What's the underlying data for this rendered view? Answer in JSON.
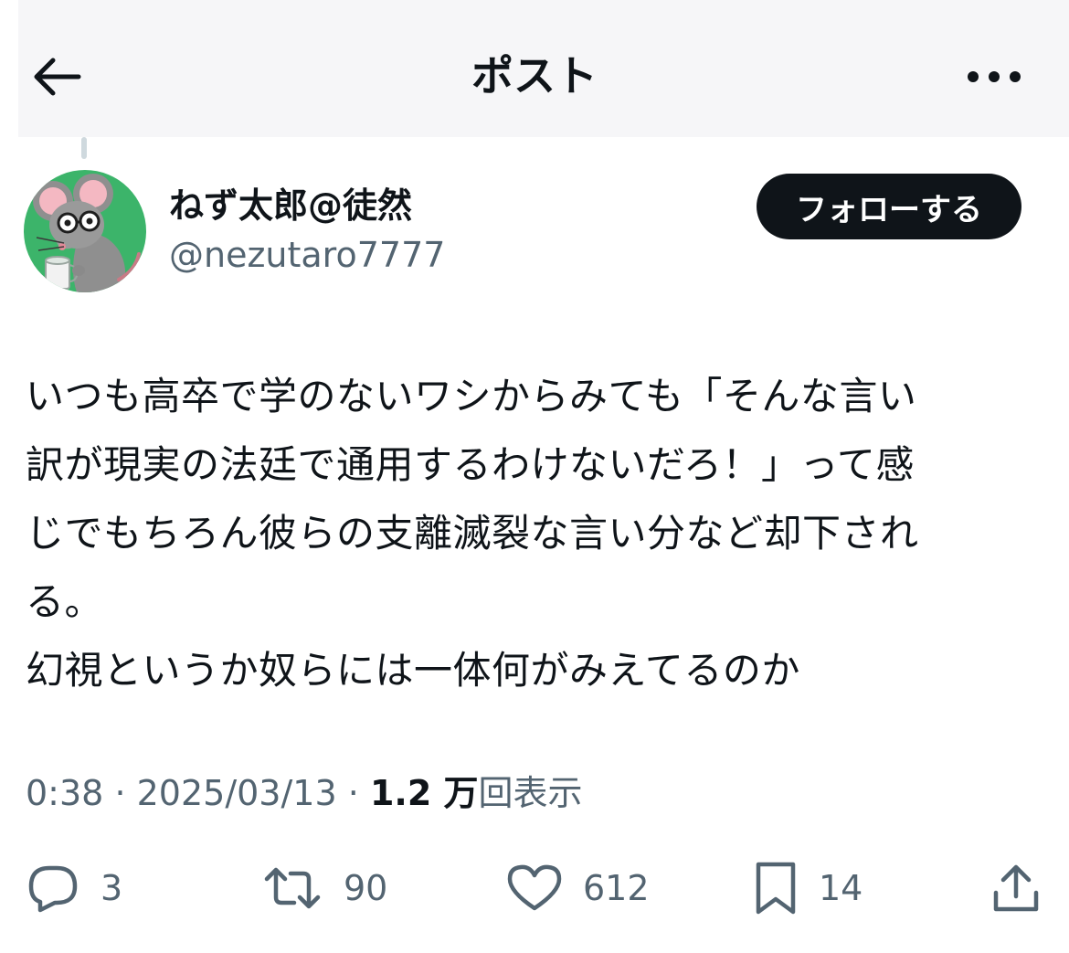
{
  "header": {
    "title": "ポスト",
    "back_icon": "arrow-left-icon",
    "more_icon": "more-horizontal-icon"
  },
  "author": {
    "display_name": "ねず太郎@徒然",
    "handle": "@nezutaro7777",
    "avatar_icon": "mouse-avatar-icon",
    "follow_label": "フォローする"
  },
  "post": {
    "text": "いつも高卒で学のないワシからみても「そんな言い\n訳が現実の法廷で通用するわけないだろ！」って感\nじでもちろん彼らの支離滅裂な言い分など却下され\nる。\n幻視というか奴らには一体何がみえてるのか"
  },
  "meta": {
    "time": "0:38",
    "separator": "·",
    "date": "2025/03/13",
    "views_count": "1.2 万",
    "views_label": "回表示"
  },
  "actions": {
    "reply_count": "3",
    "repost_count": "90",
    "like_count": "612",
    "bookmark_count": "14",
    "reply_icon": "reply-icon",
    "repost_icon": "repost-icon",
    "like_icon": "heart-icon",
    "bookmark_icon": "bookmark-icon",
    "share_icon": "share-icon"
  },
  "colors": {
    "text_primary": "#0f1419",
    "text_secondary": "#536471",
    "avatar_bg": "#3cb46a",
    "follow_bg": "#0f1419"
  }
}
